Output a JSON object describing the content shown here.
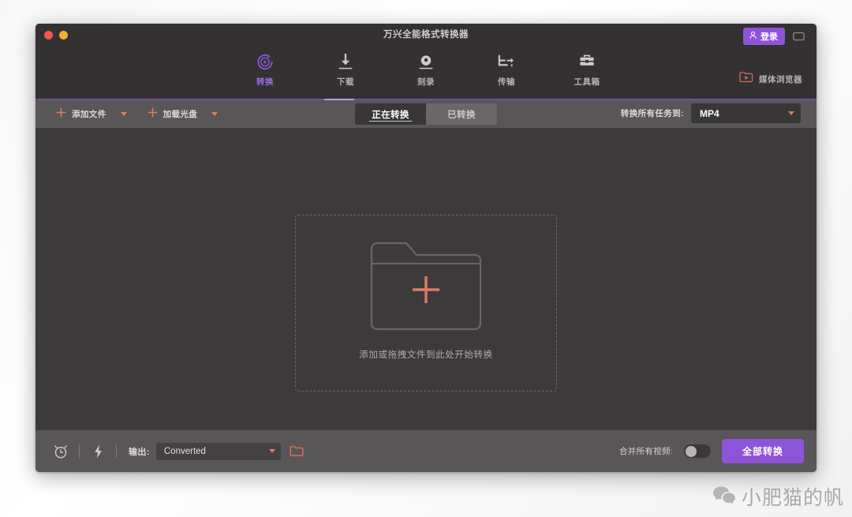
{
  "window": {
    "title": "万兴全能格式转换器",
    "traffic_lights": [
      "close",
      "minimize"
    ],
    "colors": {
      "accent_purple": "#8e54d8",
      "accent_coral": "#e07a62",
      "titlebar_bg": "#343132",
      "toolbar_bg": "#595657",
      "content_bg": "#3d3a3b",
      "rule_purple": "#6d4f9e"
    }
  },
  "topbar": {
    "login_label": "登录",
    "login_icon": "person-icon",
    "chat_icon": "chat-bubble-icon"
  },
  "nav": {
    "items": [
      {
        "label": "转换",
        "icon": "convert-play-icon",
        "active": true
      },
      {
        "label": "下载",
        "icon": "download-arrow-icon",
        "active": false
      },
      {
        "label": "刻录",
        "icon": "burn-disc-icon",
        "active": false
      },
      {
        "label": "传输",
        "icon": "transfer-icon",
        "active": false
      },
      {
        "label": "工具箱",
        "icon": "toolbox-icon",
        "active": false
      }
    ],
    "media_browser_label": "媒体浏览器",
    "media_browser_icon": "folder-play-icon"
  },
  "toolbar": {
    "add_file_label": "添加文件",
    "add_file_icon": "plus-icon",
    "add_file_caret": "caret-down-icon",
    "load_disc_label": "加载光盘",
    "load_disc_icon": "plus-icon",
    "load_disc_caret": "caret-down-icon",
    "tabs": [
      {
        "label": "正在转换",
        "active": true
      },
      {
        "label": "已转换",
        "active": false
      }
    ],
    "convert_all_to_label": "转换所有任务到:",
    "format_value": "MP4",
    "format_caret": "caret-down-icon"
  },
  "dropzone": {
    "icon": "folder-plus-icon",
    "hint": "添加或拖拽文件到此处开始转换"
  },
  "bottombar": {
    "timer_icon": "alarm-clock-icon",
    "speed_icon": "lightning-bolt-icon",
    "output_label": "输出:",
    "output_value": "Converted",
    "output_caret": "caret-down-icon",
    "open_folder_icon": "folder-open-icon",
    "merge_label": "合并所有视频:",
    "merge_enabled": false,
    "convert_all_label": "全部转换"
  },
  "watermark": {
    "icon": "wechat-icon",
    "text": "小肥猫的帆"
  }
}
